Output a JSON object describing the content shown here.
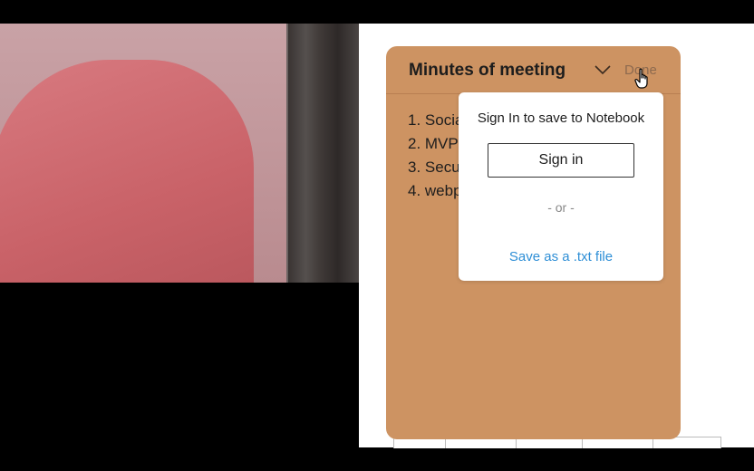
{
  "notes_card": {
    "title": "Minutes of meeting",
    "done_label": "Done",
    "background_color": "#cd9362",
    "list_items": [
      "1. Socia",
      "2. MVP",
      "3. Secu",
      "4. webp"
    ]
  },
  "save_popup": {
    "prompt": "Sign In to save to Notebook",
    "sign_in_label": "Sign in",
    "or_text": "- or -",
    "save_txt_label": "Save as a .txt file",
    "link_color": "#2f8fd6"
  },
  "icons": {
    "collapse": "chevron-down-icon",
    "cursor": "hand-pointer-icon"
  }
}
